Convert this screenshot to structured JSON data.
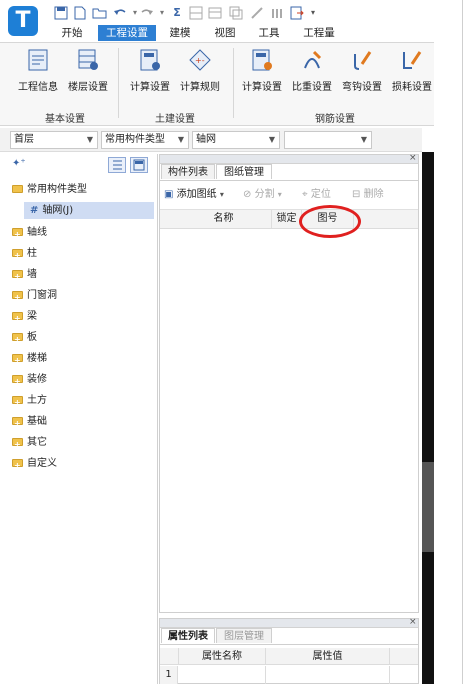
{
  "app": {
    "logo_letter": "T"
  },
  "quick_access": [
    "save-icon",
    "doc-icon",
    "open-icon",
    "undo-icon",
    "redo-icon",
    "sum-icon",
    "grid-icon",
    "table-icon",
    "copy-icon",
    "erase-icon",
    "bar-icon",
    "export-icon"
  ],
  "menu_tabs": [
    {
      "label": "开始",
      "active": false
    },
    {
      "label": "工程设置",
      "active": true
    },
    {
      "label": "建模",
      "active": false
    },
    {
      "label": "视图",
      "active": false
    },
    {
      "label": "工具",
      "active": false
    },
    {
      "label": "工程量",
      "active": false
    }
  ],
  "ribbon": {
    "buttons": [
      {
        "label": "工程信息",
        "icon": "project-info-icon"
      },
      {
        "label": "楼层设置",
        "icon": "floor-settings-icon"
      },
      {
        "label": "计算设置",
        "icon": "calc-settings-icon"
      },
      {
        "label": "计算规则",
        "icon": "calc-rules-icon"
      },
      {
        "label": "计算设置",
        "icon": "rebar-calc-settings-icon"
      },
      {
        "label": "比重设置",
        "icon": "weight-settings-icon"
      },
      {
        "label": "弯钩设置",
        "icon": "hook-settings-icon"
      },
      {
        "label": "损耗设置",
        "icon": "loss-settings-icon"
      }
    ],
    "groups": [
      "基本设置",
      "土建设置",
      "钢筋设置"
    ]
  },
  "selectors": [
    {
      "value": "首层"
    },
    {
      "value": "常用构件类型"
    },
    {
      "value": "轴网"
    },
    {
      "value": ""
    }
  ],
  "tree": {
    "root": "常用构件类型",
    "selected": "轴网(J)",
    "items": [
      "轴线",
      "柱",
      "墙",
      "门窗洞",
      "梁",
      "板",
      "楼梯",
      "装修",
      "土方",
      "基础",
      "其它",
      "自定义"
    ]
  },
  "drawing_panel": {
    "tabs": [
      {
        "label": "构件列表",
        "active": false
      },
      {
        "label": "图纸管理",
        "active": true
      }
    ],
    "toolbar": [
      {
        "label": "添加图纸",
        "enabled": true
      },
      {
        "label": "分割",
        "enabled": false
      },
      {
        "label": "定位",
        "enabled": false
      },
      {
        "label": "删除",
        "enabled": false
      }
    ],
    "columns": [
      "名称",
      "锁定",
      "图号"
    ]
  },
  "prop_panel": {
    "tabs": [
      {
        "label": "属性列表",
        "active": true
      },
      {
        "label": "图层管理",
        "active": false
      }
    ],
    "columns": [
      "属性名称",
      "属性值"
    ],
    "rows": [
      {
        "index": "1",
        "name": "",
        "value": ""
      }
    ]
  },
  "colors": {
    "accent": "#2d7fd3",
    "highlight": "#e0201f",
    "folder": "#f0c24b"
  }
}
